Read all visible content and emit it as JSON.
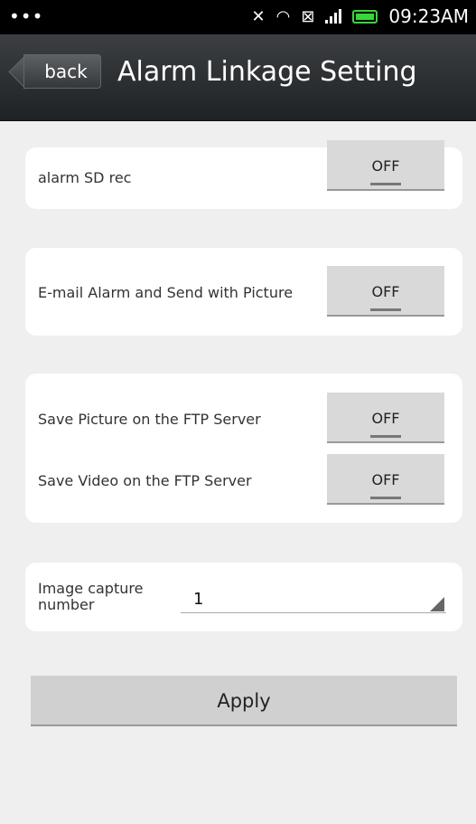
{
  "status_bar": {
    "dots": "•••",
    "time": "09:23AM"
  },
  "header": {
    "back_label": "back",
    "title": "Alarm Linkage Setting"
  },
  "settings": {
    "sd_rec": {
      "label": "alarm SD rec",
      "value": "OFF"
    },
    "email": {
      "label": "E-mail Alarm and Send with Picture",
      "value": "OFF"
    },
    "ftp_picture": {
      "label": "Save Picture on the FTP Server",
      "value": "OFF"
    },
    "ftp_video": {
      "label": "Save Video on the FTP Server",
      "value": "OFF"
    }
  },
  "capture": {
    "label": "Image capture number",
    "value": "1"
  },
  "apply_label": "Apply",
  "colors": {
    "battery": "#39d639",
    "titlebar": "#2d3033",
    "background": "#efefef"
  }
}
